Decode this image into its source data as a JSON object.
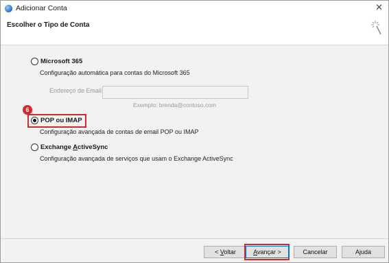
{
  "window": {
    "title": "Adicionar Conta",
    "close_glyph": "✕"
  },
  "header": {
    "title": "Escolher o Tipo de Conta"
  },
  "options": [
    {
      "label": "Microsoft 365",
      "description": "Configuração automática para contas do Microsoft 365",
      "selected": false
    },
    {
      "label": "POP ou IMAP",
      "description": "Configuração avançada de contas de email POP ou IMAP",
      "selected": true
    },
    {
      "label_pre": "Exchange ",
      "label_accel": "A",
      "label_post": "ctiveSync",
      "description": "Configuração avançada de serviços que usam o Exchange ActiveSync",
      "selected": false
    }
  ],
  "email": {
    "label": "Endereço de Email:",
    "value": "",
    "example": "Exemplo: brenda@contoso.com"
  },
  "step_badge": "6",
  "buttons": {
    "back_accel": "V",
    "back_pre": "< ",
    "back_post": "oltar",
    "next_accel": "A",
    "next_post": "vançar >",
    "cancel": "Cancelar",
    "help": "Ajuda"
  },
  "colors": {
    "highlight": "#d6272b",
    "content_bg": "#f2f2f2",
    "primary_border": "#0078d7"
  }
}
